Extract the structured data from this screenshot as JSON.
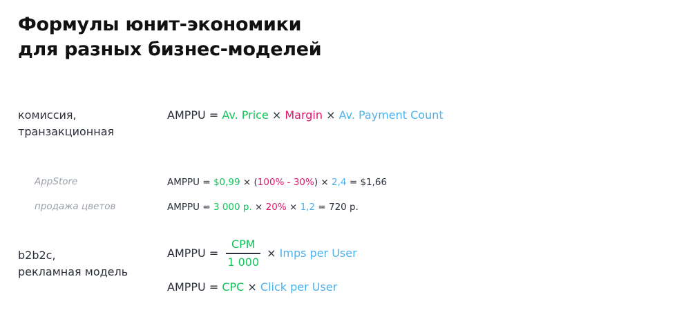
{
  "title": {
    "line1": "Формулы юнит-экономики",
    "line2": "для разных бизнес-моделей"
  },
  "commission": {
    "label_line1": "комиссия,",
    "label_line2": "транзакционная",
    "formula": {
      "metric": "AMPPU",
      "eq": " = ",
      "price": "Av. Price",
      "times": " × ",
      "margin": "Margin",
      "count": "Av. Payment Count"
    }
  },
  "examples": [
    {
      "label": "AppStore",
      "metric": "AMPPU",
      "eq": " = ",
      "price": "$0,99",
      "times": " × ",
      "open": "(",
      "margin": "100% - 30%",
      "close": ")",
      "count": "2,4",
      "result": "$1,66"
    },
    {
      "label": "продажа цветов",
      "metric": "AMPPU",
      "eq": " = ",
      "price": "3 000 р.",
      "times": " × ",
      "margin": "20%",
      "count": "1,2",
      "result": "720 р."
    }
  ],
  "b2b2c": {
    "label_line1": "b2b2c,",
    "label_line2": "рекламная модель",
    "formula1": {
      "metric": "AMPPU",
      "eq": " = ",
      "numerator": "CPM",
      "denominator": "1 000",
      "times": "× ",
      "imps": "Imps per User"
    },
    "formula2": {
      "metric": "AMPPU",
      "eq": " = ",
      "cpc": "CPC",
      "times": " × ",
      "clicks": "Click per User"
    }
  },
  "colors": {
    "green": "#10c45a",
    "pink": "#e0176a",
    "blue": "#4cb2ee",
    "text": "#2a2f3a"
  }
}
